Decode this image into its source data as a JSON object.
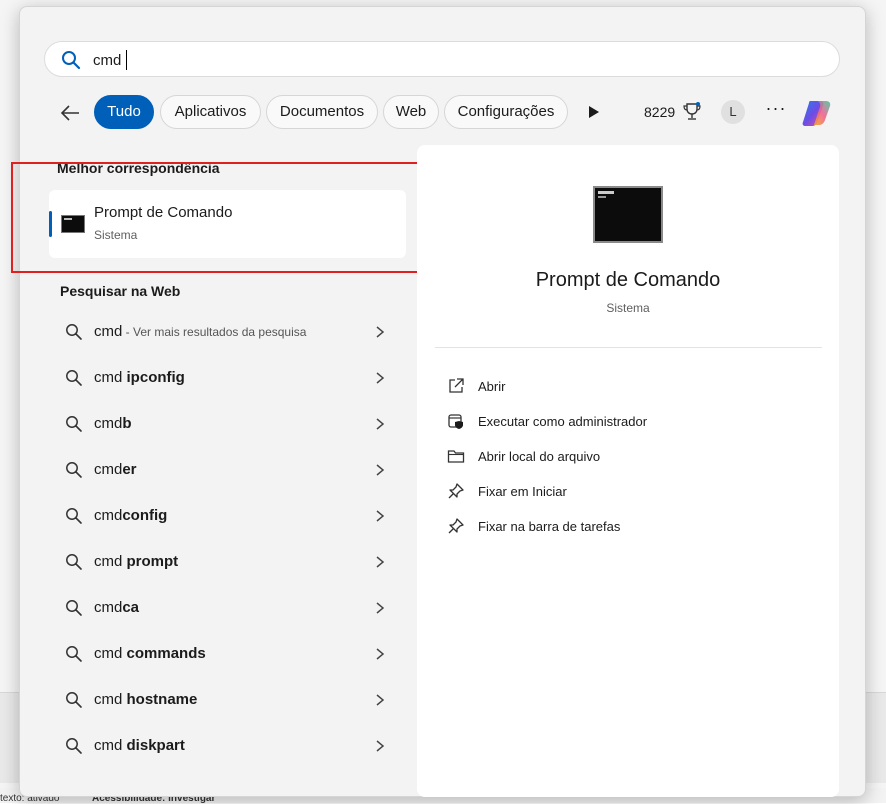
{
  "search": {
    "query": "cmd"
  },
  "filters": {
    "tabs": [
      "Tudo",
      "Aplicativos",
      "Documentos",
      "Web",
      "Configurações"
    ],
    "active_tab": "Tudo",
    "points": "8229",
    "avatar_letter": "L",
    "more_label": "···"
  },
  "best_match": {
    "section_title": "Melhor correspondência",
    "app_name": "Prompt de Comando",
    "app_type": "Sistema"
  },
  "web": {
    "section_title": "Pesquisar na Web",
    "items": [
      {
        "prefix": "cmd",
        "bold": "",
        "hint": " - Ver mais resultados da pesquisa"
      },
      {
        "prefix": "cmd ",
        "bold": "ipconfig",
        "hint": ""
      },
      {
        "prefix": "cmd",
        "bold": "b",
        "hint": ""
      },
      {
        "prefix": "cmd",
        "bold": "er",
        "hint": ""
      },
      {
        "prefix": "cmd",
        "bold": "config",
        "hint": ""
      },
      {
        "prefix": "cmd ",
        "bold": "prompt",
        "hint": ""
      },
      {
        "prefix": "cmd",
        "bold": "ca",
        "hint": ""
      },
      {
        "prefix": "cmd ",
        "bold": "commands",
        "hint": ""
      },
      {
        "prefix": "cmd ",
        "bold": "hostname",
        "hint": ""
      },
      {
        "prefix": "cmd ",
        "bold": "diskpart",
        "hint": ""
      }
    ]
  },
  "details": {
    "title": "Prompt de Comando",
    "subtitle": "Sistema",
    "actions": [
      {
        "label": "Abrir",
        "icon": "open-external-icon"
      },
      {
        "label": "Executar como administrador",
        "icon": "shield-admin-icon"
      },
      {
        "label": "Abrir local do arquivo",
        "icon": "folder-icon"
      },
      {
        "label": "Fixar em Iniciar",
        "icon": "pin-icon"
      },
      {
        "label": "Fixar na barra de tarefas",
        "icon": "pin-icon"
      }
    ]
  },
  "background": {
    "status_left": "texto: ativado",
    "status_right": "Acessibilidade: investigar"
  },
  "colors": {
    "accent": "#005fb8",
    "highlight_box": "#e02020"
  }
}
